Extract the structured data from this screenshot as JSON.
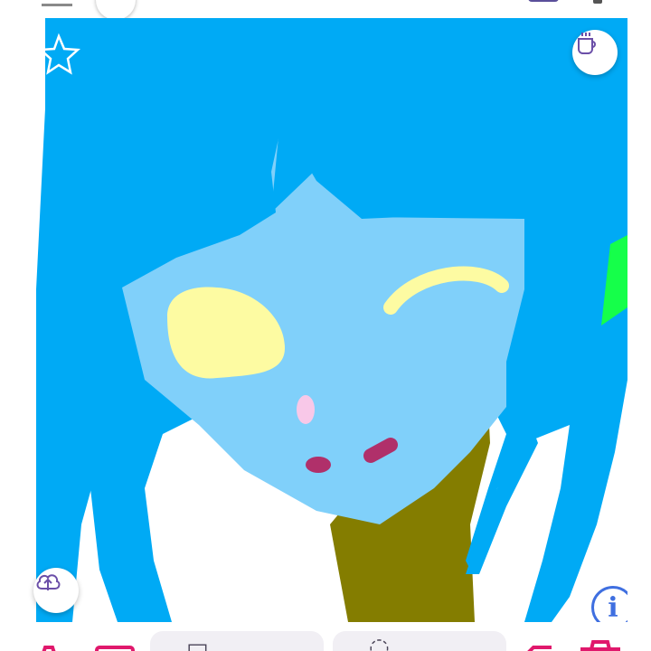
{
  "app": {
    "accent_color": "#e0186c",
    "canvas_background": "#ffffff"
  },
  "top_bar": {
    "menu_icon": "menu-icon",
    "avatar_icon": "avatar-icon",
    "gallery_icon": "gallery-icon",
    "overflow_icon": "more-icon"
  },
  "canvas": {
    "description_colors": {
      "hair": "#00aaf5",
      "face": "#80d0fa",
      "eye": "#fdfba2",
      "closed_eye": "#fdfba2",
      "blush": "#f8c8e8",
      "mouth": "#b0306a",
      "neck": "#847d00",
      "ribbon": "#15ff4a"
    },
    "star_icon": "star-icon",
    "coffee_button": {
      "icon": "coffee-icon"
    },
    "upload_button": {
      "icon": "upload-cloud-icon"
    },
    "info_button": {
      "icon": "info-icon",
      "label": "i"
    }
  },
  "bottom_bar": {
    "items": [
      {
        "icon": "settings-icon"
      },
      {
        "icon": "image-icon"
      },
      {
        "label": "",
        "icon": "layers-icon"
      },
      {
        "label": "",
        "icon": "brush-icon"
      },
      {
        "icon": "undo-icon"
      },
      {
        "icon": "trash-icon"
      }
    ]
  }
}
